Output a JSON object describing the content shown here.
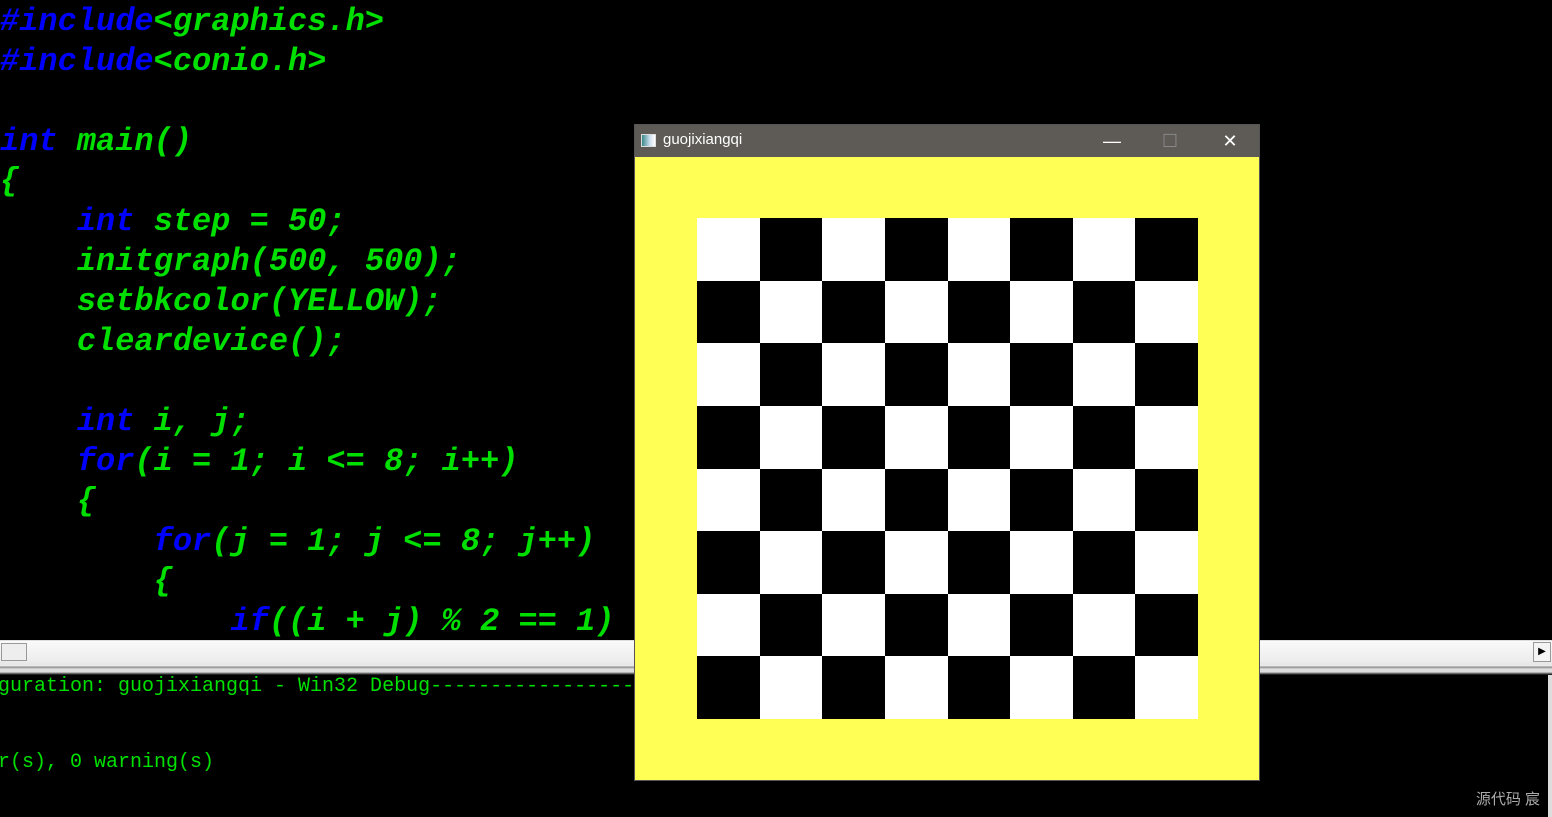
{
  "editor": {
    "lines": [
      [
        {
          "t": "#include",
          "k": 1
        },
        {
          "t": "<graphics.h>"
        }
      ],
      [
        {
          "t": "#include",
          "k": 1
        },
        {
          "t": "<conio.h>"
        }
      ],
      [],
      [
        {
          "t": "int",
          "k": 1
        },
        {
          "t": " main()"
        }
      ],
      [
        {
          "t": "{"
        }
      ],
      [
        {
          "t": "    "
        },
        {
          "t": "int",
          "k": 1
        },
        {
          "t": " step = 50;"
        }
      ],
      [
        {
          "t": "    initgraph(500, 500);"
        }
      ],
      [
        {
          "t": "    setbkcolor(YELLOW);"
        }
      ],
      [
        {
          "t": "    cleardevice();"
        }
      ],
      [],
      [
        {
          "t": "    "
        },
        {
          "t": "int",
          "k": 1
        },
        {
          "t": " i, j;"
        }
      ],
      [
        {
          "t": "    "
        },
        {
          "t": "for",
          "k": 1
        },
        {
          "t": "(i = 1; i <= 8; i++)"
        }
      ],
      [
        {
          "t": "    {"
        }
      ],
      [
        {
          "t": "        "
        },
        {
          "t": "for",
          "k": 1
        },
        {
          "t": "(j = 1; j <= 8; j++)"
        }
      ],
      [
        {
          "t": "        {"
        }
      ],
      [
        {
          "t": "            "
        },
        {
          "t": "if",
          "k": 1
        },
        {
          "t": "((i + j) % 2 == 1)"
        }
      ]
    ]
  },
  "output": {
    "line1": "guration: guojixiangqi - Win32 Debug--------------------",
    "line2": "r(s), 0 warning(s)"
  },
  "scroll_right": "▶",
  "watermark": "源代码  宸",
  "window": {
    "title": "guojixiangqi",
    "minimize": "—",
    "maximize": "☐",
    "close": "✕",
    "background": "#ffff55",
    "board_size": 8,
    "top_left_color": "white"
  }
}
